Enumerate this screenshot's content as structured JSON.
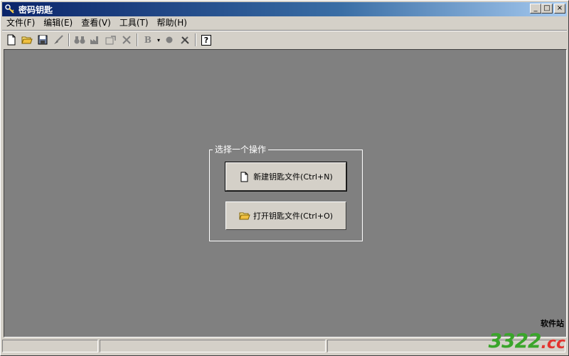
{
  "window": {
    "title": "密码钥匙",
    "minimize": "_",
    "maximize": "□",
    "close": "×"
  },
  "menu": [
    {
      "label": "文件(F)"
    },
    {
      "label": "编辑(E)"
    },
    {
      "label": "查看(V)"
    },
    {
      "label": "工具(T)"
    },
    {
      "label": "帮助(H)"
    }
  ],
  "toolbar": {
    "icons": [
      "new-file-icon",
      "open-folder-icon",
      "save-icon",
      "brush-icon",
      "binoculars-icon",
      "factory-icon",
      "export-icon",
      "delete-icon",
      "bold-icon",
      "record-icon",
      "tools-icon",
      "help-icon"
    ],
    "bold_label": "B",
    "help_label": "?"
  },
  "main": {
    "group_title": "选择一个操作",
    "new_button": "新建钥匙文件(Ctrl+N)",
    "open_button": "打开钥匙文件(Ctrl+O)"
  },
  "watermark": {
    "main": "3322",
    "suffix": ".cc",
    "sub": "软件站"
  },
  "colors": {
    "client_bg": "#808080",
    "titlebar_start": "#0a246a",
    "watermark_green": "#3aa52a",
    "watermark_red": "#e3342f"
  }
}
